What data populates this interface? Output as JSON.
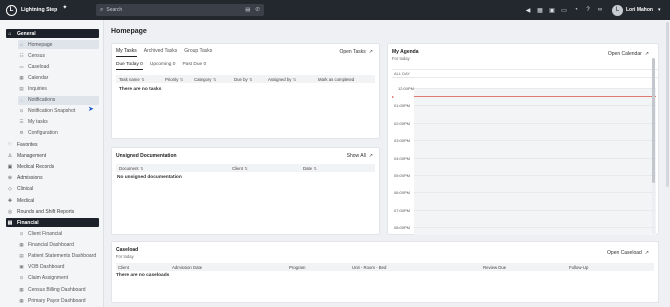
{
  "app": {
    "name": "Lightning Step",
    "logo_letter": "L"
  },
  "search": {
    "placeholder": "Search"
  },
  "topbar_icons": [
    "megaphone-icon",
    "calendar-icon",
    "grid-icon",
    "chat-icon",
    "bell-icon",
    "help-icon",
    "link-icon"
  ],
  "user": {
    "name": "Lori Mahon",
    "initial": "L"
  },
  "sidebar": {
    "general_label": "General",
    "general_items": [
      {
        "label": "Homepage",
        "icon": "home-icon",
        "glyph": "⌂",
        "selected": true
      },
      {
        "label": "Census",
        "icon": "census-icon",
        "glyph": "☷"
      },
      {
        "label": "Caseload",
        "icon": "caseload-icon",
        "glyph": "▭"
      },
      {
        "label": "Calendar",
        "icon": "calendar-icon",
        "glyph": "▦"
      },
      {
        "label": "Inquiries",
        "icon": "inquiries-icon",
        "glyph": "▤"
      },
      {
        "label": "Notifications",
        "icon": "bell-icon",
        "glyph": "◌",
        "selected_hover": true
      },
      {
        "label": "Notification Snapshot",
        "icon": "snapshot-icon",
        "glyph": "⊙"
      },
      {
        "label": "My tasks",
        "icon": "tasks-icon",
        "glyph": "☰"
      },
      {
        "label": "Configuration",
        "icon": "gear-icon",
        "glyph": "⚙"
      }
    ],
    "sections": [
      {
        "label": "Favorites",
        "icon": "heart-icon",
        "glyph": "♡"
      },
      {
        "label": "Management",
        "icon": "management-icon",
        "glyph": "♙"
      },
      {
        "label": "Medical Records",
        "icon": "records-icon",
        "glyph": "▣"
      },
      {
        "label": "Admissions",
        "icon": "admissions-icon",
        "glyph": "⊕"
      },
      {
        "label": "Clinical",
        "icon": "clinical-icon",
        "glyph": "◇"
      },
      {
        "label": "Medical",
        "icon": "medical-icon",
        "glyph": "✚"
      },
      {
        "label": "Rounds and Shift Reports",
        "icon": "rounds-icon",
        "glyph": "◎"
      }
    ],
    "financial_label": "Financial",
    "financial_items": [
      {
        "label": "Client Financial",
        "icon": "financial-icon",
        "glyph": "⊙"
      },
      {
        "label": "Financial Dashboard",
        "icon": "dashboard-icon",
        "glyph": "▦"
      },
      {
        "label": "Patient Statements Dashboard",
        "icon": "statements-icon",
        "glyph": "▤"
      },
      {
        "label": "VOB Dashboard",
        "icon": "vob-icon",
        "glyph": "▣"
      },
      {
        "label": "Claim Assignment",
        "icon": "claim-icon",
        "glyph": "⊙"
      },
      {
        "label": "Census Billing Dashboard",
        "icon": "billing-icon",
        "glyph": "▦"
      },
      {
        "label": "Primary Payor Dashboard",
        "icon": "payor-icon",
        "glyph": "▦"
      }
    ]
  },
  "page": {
    "title": "Homepage"
  },
  "tasks": {
    "tabs": [
      "My Tasks",
      "Archived Tasks",
      "Group Tasks"
    ],
    "open_link": "Open Tasks",
    "subtabs": [
      "Due Today 0",
      "Upcoming 0",
      "Past Due 0"
    ],
    "columns": [
      "Task name",
      "Priority",
      "Category",
      "Due by",
      "Assigned by",
      "Mark as completed"
    ],
    "empty": "There are no tasks"
  },
  "docs": {
    "title": "Unsigned Documentation",
    "show_all": "Show All",
    "columns": [
      "Document",
      "Client",
      "Date"
    ],
    "empty": "No unsigned documentation"
  },
  "agenda": {
    "title": "My Agenda",
    "subtitle": "For today",
    "open_link": "Open Calendar",
    "all_day": "ALL DAY",
    "hours": [
      "12:00PM",
      "01:00PM",
      "02:00PM",
      "03:00PM",
      "04:00PM",
      "05:00PM",
      "06:00PM",
      "07:00PM",
      "08:00PM"
    ]
  },
  "caseload": {
    "title": "Caseload",
    "subtitle": "For today",
    "open_link": "Open Caseload",
    "columns": [
      "Client",
      "Admission Date",
      "Program",
      "Unit - Room - Bed",
      "Review Due",
      "Follow-Up"
    ],
    "empty": "There are no caseloads"
  }
}
